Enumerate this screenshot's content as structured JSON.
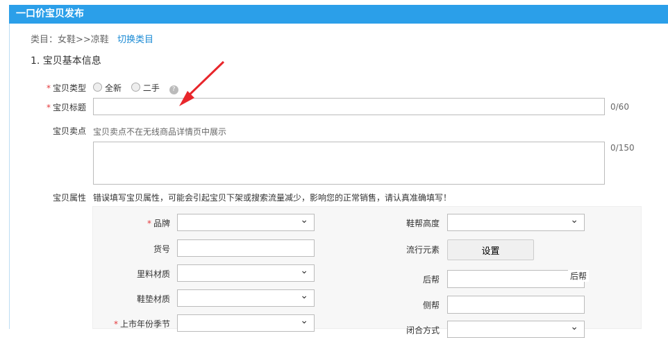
{
  "header": {
    "title": "一口价宝贝发布"
  },
  "category": {
    "label": "类目：女鞋>>凉鞋",
    "switch_link": "切换类目"
  },
  "section": {
    "title": "1. 宝贝基本信息"
  },
  "form": {
    "type": {
      "label": "宝贝类型",
      "options": [
        "全新",
        "二手"
      ],
      "help": "?"
    },
    "title": {
      "label": "宝贝标题",
      "value": "",
      "counter": "0/60"
    },
    "selling_point": {
      "label": "宝贝卖点",
      "hint": "宝贝卖点不在无线商品详情页中展示",
      "value": "",
      "counter": "0/150"
    },
    "attributes": {
      "label": "宝贝属性",
      "warning": "错误填写宝贝属性，可能会引起宝贝下架或搜索流量减少，影响您的正常销售，请认真准确填写！"
    }
  },
  "attributes": {
    "left": [
      {
        "label": "品牌",
        "required": true
      },
      {
        "label": "货号"
      },
      {
        "label": "里料材质"
      },
      {
        "label": "鞋垫材质"
      },
      {
        "label": "上市年份季节",
        "required": true
      }
    ],
    "right": [
      {
        "label": "鞋帮高度"
      },
      {
        "label": "流行元素",
        "button": "设置"
      },
      {
        "label": "后帮"
      },
      {
        "label": "侧帮"
      },
      {
        "label": "闭合方式"
      }
    ],
    "overlay_text": "后帮"
  }
}
